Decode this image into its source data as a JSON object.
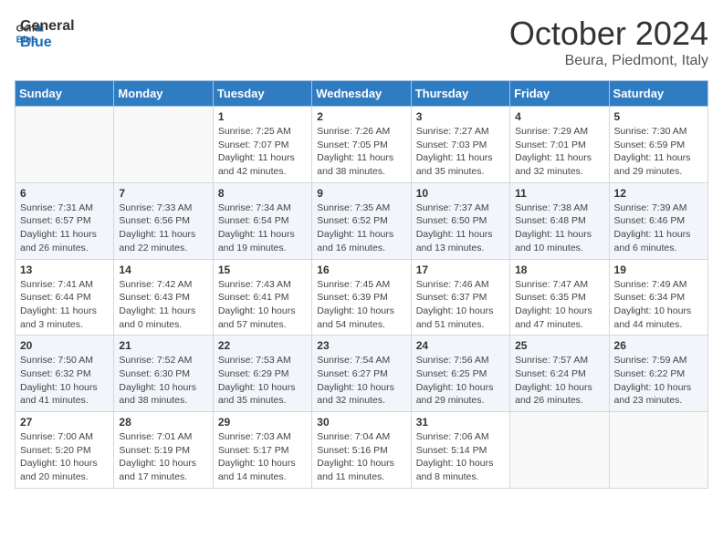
{
  "logo": {
    "line1": "General",
    "line2": "Blue"
  },
  "title": "October 2024",
  "location": "Beura, Piedmont, Italy",
  "days_of_week": [
    "Sunday",
    "Monday",
    "Tuesday",
    "Wednesday",
    "Thursday",
    "Friday",
    "Saturday"
  ],
  "weeks": [
    [
      {
        "day": "",
        "sunrise": "",
        "sunset": "",
        "daylight": ""
      },
      {
        "day": "",
        "sunrise": "",
        "sunset": "",
        "daylight": ""
      },
      {
        "day": "1",
        "sunrise": "Sunrise: 7:25 AM",
        "sunset": "Sunset: 7:07 PM",
        "daylight": "Daylight: 11 hours and 42 minutes."
      },
      {
        "day": "2",
        "sunrise": "Sunrise: 7:26 AM",
        "sunset": "Sunset: 7:05 PM",
        "daylight": "Daylight: 11 hours and 38 minutes."
      },
      {
        "day": "3",
        "sunrise": "Sunrise: 7:27 AM",
        "sunset": "Sunset: 7:03 PM",
        "daylight": "Daylight: 11 hours and 35 minutes."
      },
      {
        "day": "4",
        "sunrise": "Sunrise: 7:29 AM",
        "sunset": "Sunset: 7:01 PM",
        "daylight": "Daylight: 11 hours and 32 minutes."
      },
      {
        "day": "5",
        "sunrise": "Sunrise: 7:30 AM",
        "sunset": "Sunset: 6:59 PM",
        "daylight": "Daylight: 11 hours and 29 minutes."
      }
    ],
    [
      {
        "day": "6",
        "sunrise": "Sunrise: 7:31 AM",
        "sunset": "Sunset: 6:57 PM",
        "daylight": "Daylight: 11 hours and 26 minutes."
      },
      {
        "day": "7",
        "sunrise": "Sunrise: 7:33 AM",
        "sunset": "Sunset: 6:56 PM",
        "daylight": "Daylight: 11 hours and 22 minutes."
      },
      {
        "day": "8",
        "sunrise": "Sunrise: 7:34 AM",
        "sunset": "Sunset: 6:54 PM",
        "daylight": "Daylight: 11 hours and 19 minutes."
      },
      {
        "day": "9",
        "sunrise": "Sunrise: 7:35 AM",
        "sunset": "Sunset: 6:52 PM",
        "daylight": "Daylight: 11 hours and 16 minutes."
      },
      {
        "day": "10",
        "sunrise": "Sunrise: 7:37 AM",
        "sunset": "Sunset: 6:50 PM",
        "daylight": "Daylight: 11 hours and 13 minutes."
      },
      {
        "day": "11",
        "sunrise": "Sunrise: 7:38 AM",
        "sunset": "Sunset: 6:48 PM",
        "daylight": "Daylight: 11 hours and 10 minutes."
      },
      {
        "day": "12",
        "sunrise": "Sunrise: 7:39 AM",
        "sunset": "Sunset: 6:46 PM",
        "daylight": "Daylight: 11 hours and 6 minutes."
      }
    ],
    [
      {
        "day": "13",
        "sunrise": "Sunrise: 7:41 AM",
        "sunset": "Sunset: 6:44 PM",
        "daylight": "Daylight: 11 hours and 3 minutes."
      },
      {
        "day": "14",
        "sunrise": "Sunrise: 7:42 AM",
        "sunset": "Sunset: 6:43 PM",
        "daylight": "Daylight: 11 hours and 0 minutes."
      },
      {
        "day": "15",
        "sunrise": "Sunrise: 7:43 AM",
        "sunset": "Sunset: 6:41 PM",
        "daylight": "Daylight: 10 hours and 57 minutes."
      },
      {
        "day": "16",
        "sunrise": "Sunrise: 7:45 AM",
        "sunset": "Sunset: 6:39 PM",
        "daylight": "Daylight: 10 hours and 54 minutes."
      },
      {
        "day": "17",
        "sunrise": "Sunrise: 7:46 AM",
        "sunset": "Sunset: 6:37 PM",
        "daylight": "Daylight: 10 hours and 51 minutes."
      },
      {
        "day": "18",
        "sunrise": "Sunrise: 7:47 AM",
        "sunset": "Sunset: 6:35 PM",
        "daylight": "Daylight: 10 hours and 47 minutes."
      },
      {
        "day": "19",
        "sunrise": "Sunrise: 7:49 AM",
        "sunset": "Sunset: 6:34 PM",
        "daylight": "Daylight: 10 hours and 44 minutes."
      }
    ],
    [
      {
        "day": "20",
        "sunrise": "Sunrise: 7:50 AM",
        "sunset": "Sunset: 6:32 PM",
        "daylight": "Daylight: 10 hours and 41 minutes."
      },
      {
        "day": "21",
        "sunrise": "Sunrise: 7:52 AM",
        "sunset": "Sunset: 6:30 PM",
        "daylight": "Daylight: 10 hours and 38 minutes."
      },
      {
        "day": "22",
        "sunrise": "Sunrise: 7:53 AM",
        "sunset": "Sunset: 6:29 PM",
        "daylight": "Daylight: 10 hours and 35 minutes."
      },
      {
        "day": "23",
        "sunrise": "Sunrise: 7:54 AM",
        "sunset": "Sunset: 6:27 PM",
        "daylight": "Daylight: 10 hours and 32 minutes."
      },
      {
        "day": "24",
        "sunrise": "Sunrise: 7:56 AM",
        "sunset": "Sunset: 6:25 PM",
        "daylight": "Daylight: 10 hours and 29 minutes."
      },
      {
        "day": "25",
        "sunrise": "Sunrise: 7:57 AM",
        "sunset": "Sunset: 6:24 PM",
        "daylight": "Daylight: 10 hours and 26 minutes."
      },
      {
        "day": "26",
        "sunrise": "Sunrise: 7:59 AM",
        "sunset": "Sunset: 6:22 PM",
        "daylight": "Daylight: 10 hours and 23 minutes."
      }
    ],
    [
      {
        "day": "27",
        "sunrise": "Sunrise: 7:00 AM",
        "sunset": "Sunset: 5:20 PM",
        "daylight": "Daylight: 10 hours and 20 minutes."
      },
      {
        "day": "28",
        "sunrise": "Sunrise: 7:01 AM",
        "sunset": "Sunset: 5:19 PM",
        "daylight": "Daylight: 10 hours and 17 minutes."
      },
      {
        "day": "29",
        "sunrise": "Sunrise: 7:03 AM",
        "sunset": "Sunset: 5:17 PM",
        "daylight": "Daylight: 10 hours and 14 minutes."
      },
      {
        "day": "30",
        "sunrise": "Sunrise: 7:04 AM",
        "sunset": "Sunset: 5:16 PM",
        "daylight": "Daylight: 10 hours and 11 minutes."
      },
      {
        "day": "31",
        "sunrise": "Sunrise: 7:06 AM",
        "sunset": "Sunset: 5:14 PM",
        "daylight": "Daylight: 10 hours and 8 minutes."
      },
      {
        "day": "",
        "sunrise": "",
        "sunset": "",
        "daylight": ""
      },
      {
        "day": "",
        "sunrise": "",
        "sunset": "",
        "daylight": ""
      }
    ]
  ]
}
